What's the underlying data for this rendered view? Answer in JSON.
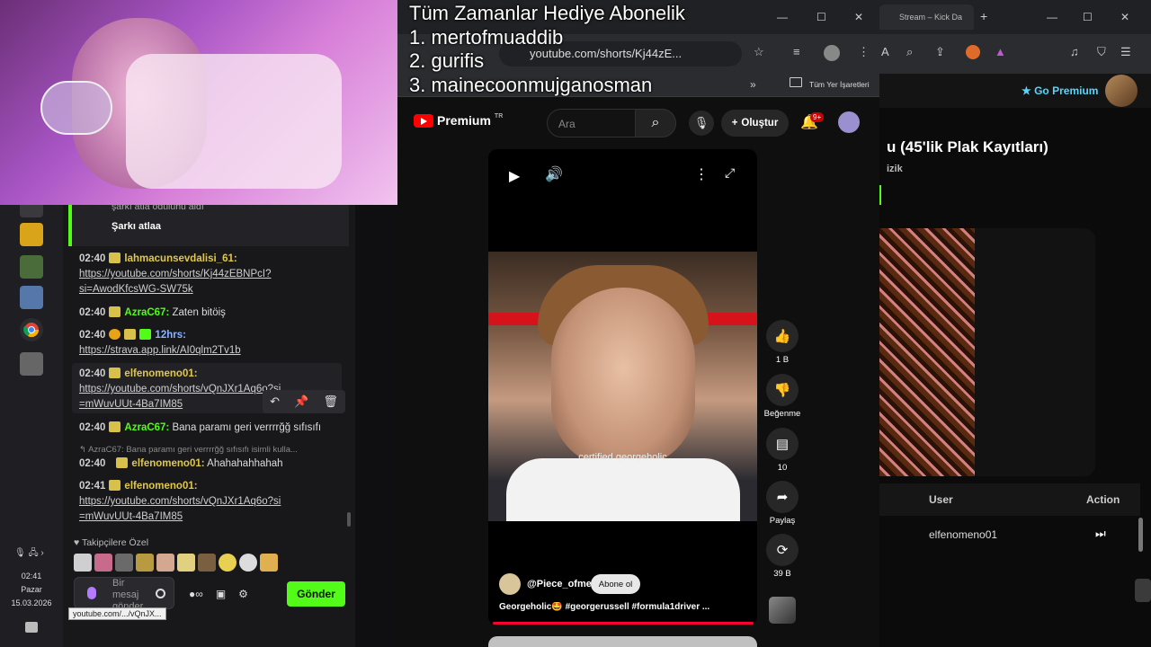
{
  "overlay": {
    "heading": "Tüm Zamanlar Hediye  Abonelik",
    "line1": "1. mertofmuaddib",
    "line2": "2. gurifis",
    "line3": "3. mainecoonmujganosman"
  },
  "taskbar": {
    "time": "02:41",
    "day": "Pazar",
    "date": "15.03.2026"
  },
  "chat": {
    "reward_text": "şarkı atla ödülünü aldı",
    "reward_name": "Şarkı atlaa",
    "messages": [
      {
        "time": "02:40",
        "user": "lahmacunsevdalisi_61:",
        "user_color": "#e0c84a",
        "text": "",
        "link": "https://youtube.com/shorts/Kj44zEBNPcI?si=AwodKfcsWG-SW75k"
      },
      {
        "time": "02:40",
        "user": "AzraC67:",
        "user_color": "#53fc18",
        "text": "Zaten bitöiş",
        "link": ""
      },
      {
        "time": "02:40",
        "user": "12hrs:",
        "user_color": "#8ab4ff",
        "text": "",
        "link": "https://strava.app.link/AI0qlm2Tv1b"
      },
      {
        "time": "02:40",
        "user": "elfenomeno01:",
        "user_color": "#e0c84a",
        "text": "",
        "link": "https://youtube.com/shorts/vQnJXr1Aq6o?si=mWuvUUt-4Ba7IM85"
      },
      {
        "time": "02:40",
        "user": "AzraC67:",
        "user_color": "#53fc18",
        "text": "Bana paramı geri verrrrğğ sıfısıfı",
        "link": ""
      },
      {
        "time": "02:40",
        "user": "elfenomeno01:",
        "user_color": "#e0c84a",
        "text": "Ahahahahhahah",
        "link": ""
      },
      {
        "time": "02:41",
        "user": "elfenomeno01:",
        "user_color": "#e0c84a",
        "text": "",
        "link": "https://youtube.com/shorts/vQnJXr1Aq6o?si=mWuvUUt-4Ba7IM85"
      }
    ],
    "reply_preview": "AzraC67: Bana paramı geri verrrrğğ sıfısıfı isimli kulla...",
    "followers_label": "Takipçilere Özel",
    "input_placeholder": "Bir mesaj gönder",
    "send_label": "Gönder",
    "status_url": "youtube.com/.../vQnJX..."
  },
  "youtube": {
    "url": "youtube.com/shorts/Kj44zE...",
    "bookmarks_label": "Tüm Yer İşaretleri",
    "logo_text": "Premium",
    "logo_superscript": "TR",
    "search_placeholder": "Ara",
    "create_label": "Oluştur",
    "notif_count": "9+",
    "caption_overlay": "certified georgeholic",
    "channel": "@Piece_ofme",
    "subscribe_label": "Abone ol",
    "title": "Georgeholic🤩 #georgerussell #formula1driver ...",
    "likes": "1 B",
    "dislike_label": "Beğenme",
    "comments": "10",
    "share_label": "Paylaş",
    "remix_count": "39 B"
  },
  "kick": {
    "tab_title": "Stream – Kick Da",
    "go_premium": "Go Premium",
    "album_title": "u (45'lik Plak Kayıtları)",
    "album_sub": "izik",
    "col_user": "User",
    "col_action": "Action",
    "row_user": "elfenomeno01"
  },
  "colors": {
    "kick_green": "#53fc18",
    "youtube_red": "#ff0000",
    "premium_blue": "#53d7ff"
  }
}
